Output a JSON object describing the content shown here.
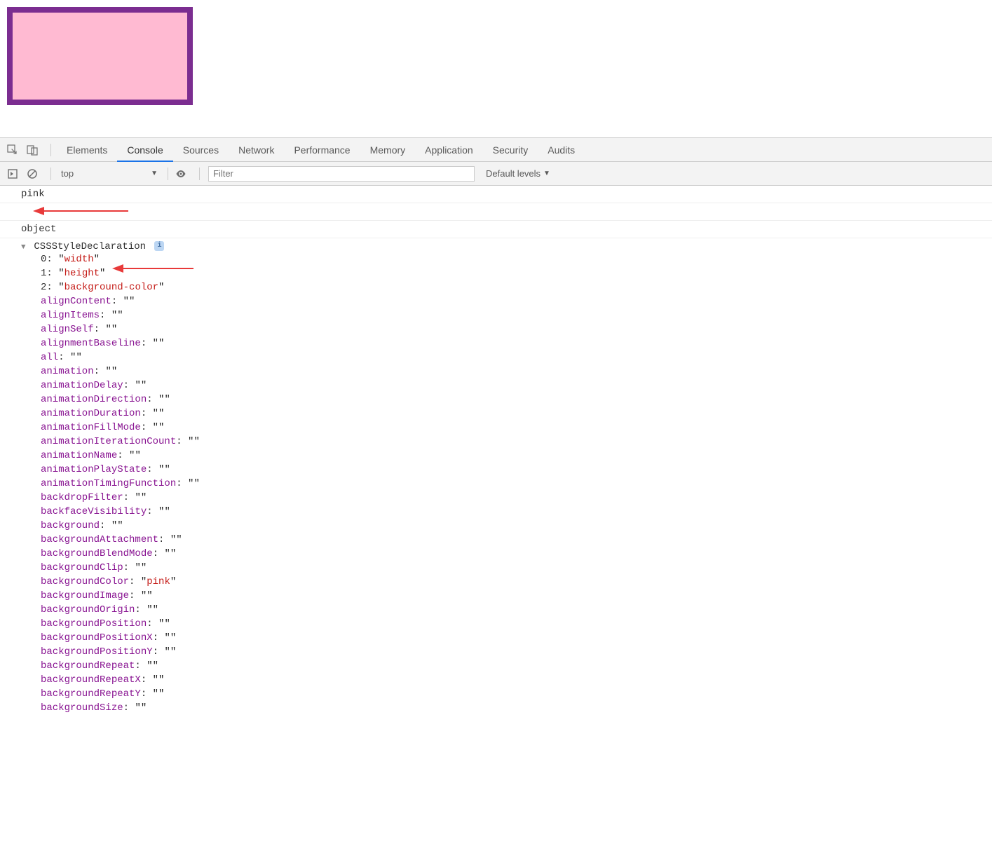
{
  "tabs": [
    "Elements",
    "Console",
    "Sources",
    "Network",
    "Performance",
    "Memory",
    "Application",
    "Security",
    "Audits"
  ],
  "active_tab": "Console",
  "context": "top",
  "filter_placeholder": "Filter",
  "levels_label": "Default levels",
  "log_pink": "pink",
  "log_object": "object",
  "obj_name": "CSSStyleDeclaration",
  "indexed": [
    {
      "idx": "0",
      "val": "width"
    },
    {
      "idx": "1",
      "val": "height"
    },
    {
      "idx": "2",
      "val": "background-color"
    }
  ],
  "props": [
    {
      "key": "alignContent",
      "val": ""
    },
    {
      "key": "alignItems",
      "val": ""
    },
    {
      "key": "alignSelf",
      "val": ""
    },
    {
      "key": "alignmentBaseline",
      "val": ""
    },
    {
      "key": "all",
      "val": ""
    },
    {
      "key": "animation",
      "val": ""
    },
    {
      "key": "animationDelay",
      "val": ""
    },
    {
      "key": "animationDirection",
      "val": ""
    },
    {
      "key": "animationDuration",
      "val": ""
    },
    {
      "key": "animationFillMode",
      "val": ""
    },
    {
      "key": "animationIterationCount",
      "val": ""
    },
    {
      "key": "animationName",
      "val": ""
    },
    {
      "key": "animationPlayState",
      "val": ""
    },
    {
      "key": "animationTimingFunction",
      "val": ""
    },
    {
      "key": "backdropFilter",
      "val": ""
    },
    {
      "key": "backfaceVisibility",
      "val": ""
    },
    {
      "key": "background",
      "val": ""
    },
    {
      "key": "backgroundAttachment",
      "val": ""
    },
    {
      "key": "backgroundBlendMode",
      "val": ""
    },
    {
      "key": "backgroundClip",
      "val": ""
    },
    {
      "key": "backgroundColor",
      "val": "pink"
    },
    {
      "key": "backgroundImage",
      "val": ""
    },
    {
      "key": "backgroundOrigin",
      "val": ""
    },
    {
      "key": "backgroundPosition",
      "val": ""
    },
    {
      "key": "backgroundPositionX",
      "val": ""
    },
    {
      "key": "backgroundPositionY",
      "val": ""
    },
    {
      "key": "backgroundRepeat",
      "val": ""
    },
    {
      "key": "backgroundRepeatX",
      "val": ""
    },
    {
      "key": "backgroundRepeatY",
      "val": ""
    },
    {
      "key": "backgroundSize",
      "val": ""
    }
  ]
}
